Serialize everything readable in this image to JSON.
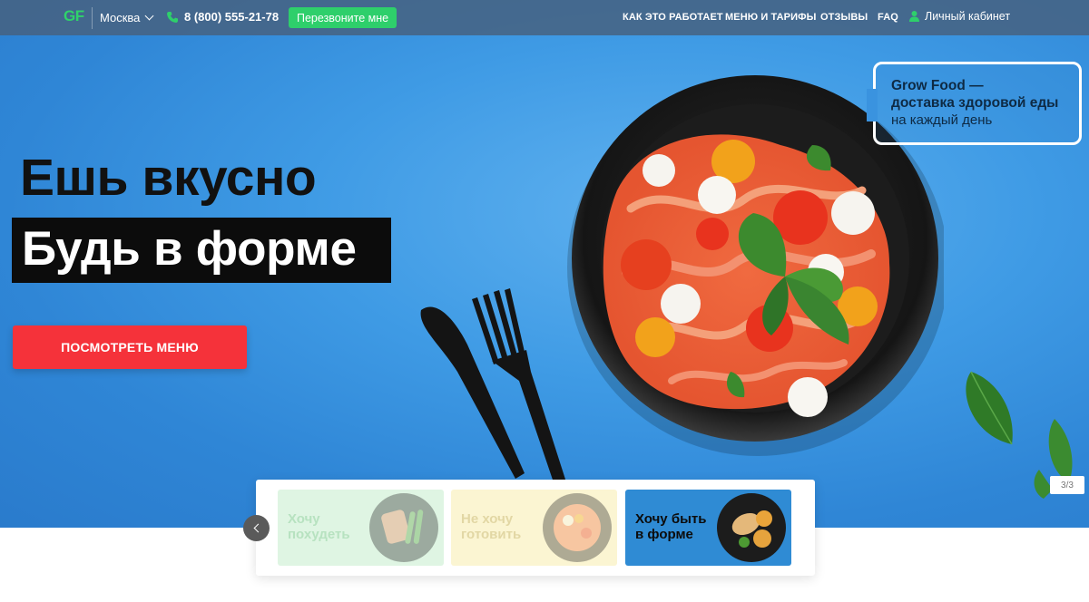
{
  "header": {
    "logo_text": "GF",
    "city": "Москва",
    "phone": "8 (800) 555-21-78",
    "callback_label": "Перезвоните мне",
    "nav": {
      "how_it_works": "КАК ЭТО РАБОТАЕТ",
      "menu_and_prices": "МЕНЮ И ТАРИФЫ",
      "reviews": "ОТЗЫВЫ",
      "faq": "FAQ"
    },
    "cabinet_label": "Личный кабинет"
  },
  "hero": {
    "headline_line1": "Ешь вкусно",
    "headline_line2": "Будь в форме",
    "cta_label": "ПОСМОТРЕТЬ МЕНЮ",
    "tagline": {
      "line1": "Grow Food —",
      "line2": "доставка здоровой еды",
      "line3": "на каждый день"
    },
    "slide_counter": "3/3"
  },
  "goals": {
    "cards": [
      {
        "label": "Хочу похудеть",
        "active": false
      },
      {
        "label": "Не хочу готовить",
        "active": false
      },
      {
        "label": "Хочу быть в форме",
        "active": true
      }
    ]
  },
  "colors": {
    "hero_blue": "#3f9be5",
    "accent_green": "#2ecf6b",
    "cta_red": "#f5323a",
    "header_bg": "#466280"
  },
  "icons": {
    "phone": "phone-icon",
    "user": "user-icon",
    "city_dropdown": "chevron-down-icon",
    "carousel_prev": "chevron-left-icon"
  }
}
